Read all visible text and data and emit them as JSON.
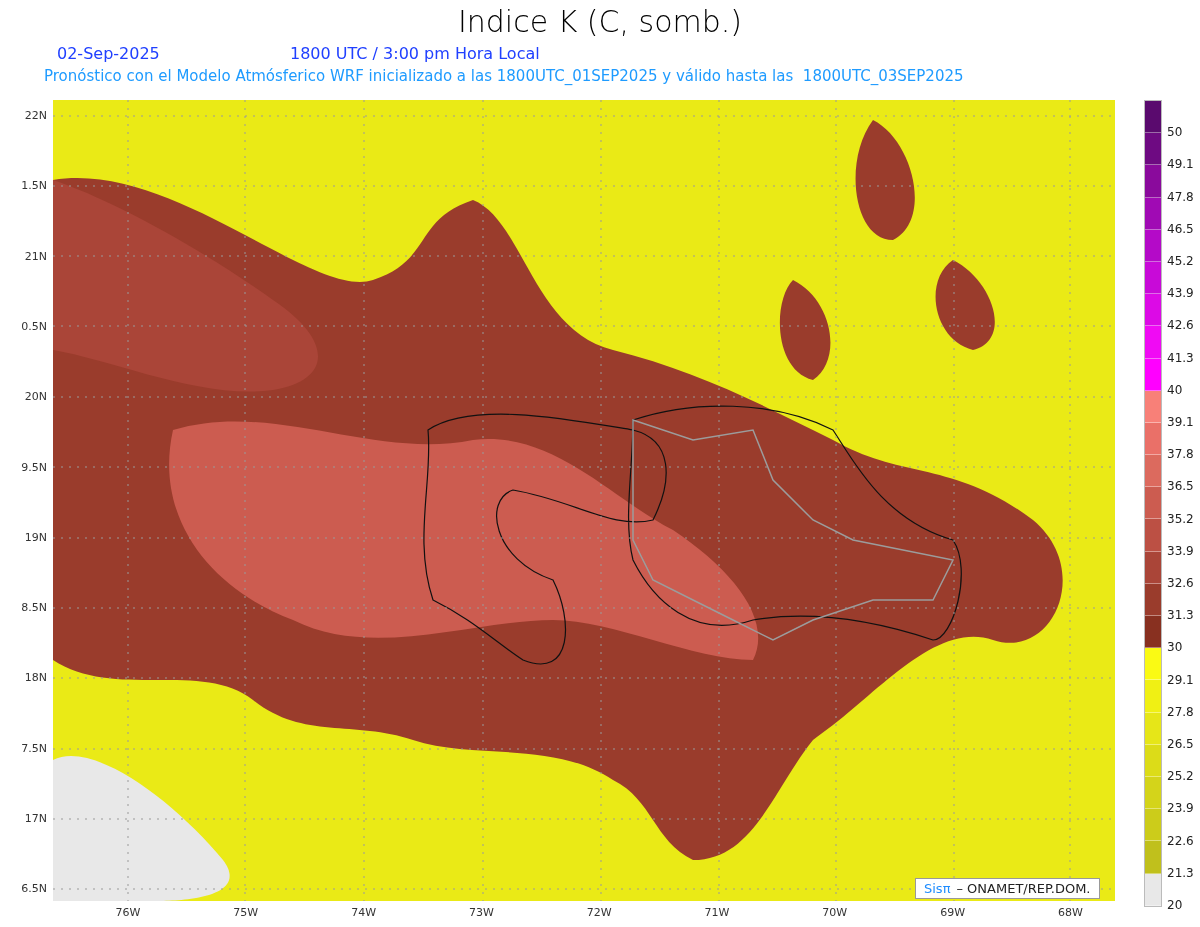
{
  "title": "Indice K (C, somb.)",
  "date": "02-Sep-2025",
  "time": "1800 UTC / 3:00 pm Hora Local",
  "subtitle": "Pronóstico con el Modelo Atmósferico WRF inicializado a las 1800UTC_01SEP2025 y válido hasta las  1800UTC_03SEP2025",
  "y_axis_labels": [
    "22N",
    "1.5N",
    "21N",
    "0.5N",
    "20N",
    "9.5N",
    "19N",
    "8.5N",
    "18N",
    "7.5N",
    "17N",
    "6.5N"
  ],
  "x_axis_labels": [
    "76W",
    "75W",
    "74W",
    "73W",
    "72W",
    "71W",
    "70W",
    "69W",
    "68W"
  ],
  "credit": {
    "brand": "Sisπ",
    "text": "– ONAMET/REP.DOM."
  },
  "colorbar": {
    "bins": [
      {
        "color": "#5a0a6e"
      },
      {
        "color": "#6e0a82"
      },
      {
        "color": "#8a0a9c"
      },
      {
        "color": "#a00ab4"
      },
      {
        "color": "#b40ac8"
      },
      {
        "color": "#c80ad8"
      },
      {
        "color": "#dc0ae6"
      },
      {
        "color": "#f00af4"
      },
      {
        "color": "#ff00ff"
      },
      {
        "color": "#f88078"
      },
      {
        "color": "#ea7068"
      },
      {
        "color": "#dc6a5e"
      },
      {
        "color": "#cc5c50"
      },
      {
        "color": "#bc5044"
      },
      {
        "color": "#aa4538"
      },
      {
        "color": "#9a3c2c"
      },
      {
        "color": "#883020"
      },
      {
        "color": "#fafa14"
      },
      {
        "color": "#f0f014"
      },
      {
        "color": "#e6e618"
      },
      {
        "color": "#dcdc18"
      },
      {
        "color": "#d4d41a"
      },
      {
        "color": "#cccc1a"
      },
      {
        "color": "#c0c01c"
      },
      {
        "color": "#e8e8e8"
      }
    ],
    "labels": [
      "50",
      "49.1",
      "47.8",
      "46.5",
      "45.2",
      "43.9",
      "42.6",
      "41.3",
      "40",
      "39.1",
      "37.8",
      "36.5",
      "35.2",
      "33.9",
      "32.6",
      "31.3",
      "30",
      "29.1",
      "27.8",
      "26.5",
      "25.2",
      "23.9",
      "22.6",
      "21.3",
      "20"
    ]
  }
}
